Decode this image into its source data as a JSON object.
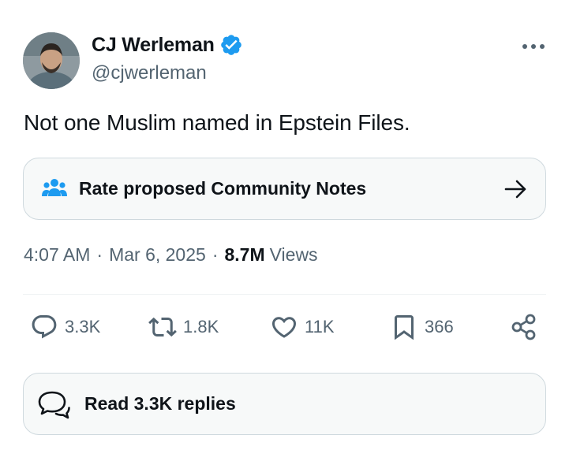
{
  "author": {
    "name": "CJ Werleman",
    "handle": "@cjwerleman",
    "verified": true
  },
  "tweet": {
    "text": "Not one Muslim named in Epstein Files."
  },
  "community_notes": {
    "label": "Rate proposed Community Notes"
  },
  "meta": {
    "time": "4:07 AM",
    "separator": "·",
    "date": "Mar 6, 2025",
    "views_count": "8.7M",
    "views_label": "Views"
  },
  "actions": {
    "replies": "3.3K",
    "reposts": "1.8K",
    "likes": "11K",
    "bookmarks": "366"
  },
  "read_replies": {
    "label": "Read 3.3K replies"
  },
  "colors": {
    "verified_badge": "#1d9bf0",
    "community_notes_icon": "#1d9bf0",
    "secondary_text": "#536471",
    "primary_text": "#0f1419"
  },
  "icons": {
    "more": "more-options-icon",
    "verified": "verified-badge-icon",
    "community_notes": "community-notes-icon",
    "arrow": "arrow-right-icon",
    "reply": "reply-icon",
    "repost": "repost-icon",
    "like": "heart-icon",
    "bookmark": "bookmark-icon",
    "share": "share-icon",
    "read_replies": "chat-bubbles-icon"
  }
}
